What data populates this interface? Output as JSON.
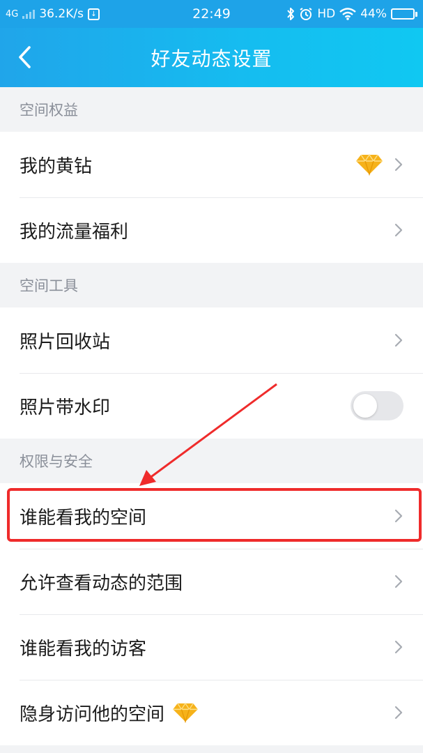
{
  "status_bar": {
    "network": "4G",
    "speed": "36.2K/s",
    "time": "22:49",
    "hd": "HD",
    "battery_percent_text": "44%",
    "battery_level": 0.44
  },
  "header": {
    "title": "好友动态设置",
    "back_icon": "chevron-left-icon"
  },
  "sections": [
    {
      "title": "空间权益",
      "items": [
        {
          "label": "我的黄钻",
          "accessory": "diamond-icon"
        },
        {
          "label": "我的流量福利"
        }
      ]
    },
    {
      "title": "空间工具",
      "items": [
        {
          "label": "照片回收站"
        },
        {
          "label": "照片带水印",
          "toggle_on": false
        }
      ]
    },
    {
      "title": "权限与安全",
      "items": [
        {
          "label": "谁能看我的空间",
          "highlighted": true
        },
        {
          "label": "允许查看动态的范围"
        },
        {
          "label": "谁能看我的访客"
        },
        {
          "label": "隐身访问他的空间",
          "inline_icon": "diamond-icon"
        }
      ]
    }
  ],
  "colors": {
    "header_start": "#20a5ea",
    "header_end": "#10c8f2",
    "annotation_red": "#ef2b2b",
    "diamond_gold": "#f6b21a"
  }
}
